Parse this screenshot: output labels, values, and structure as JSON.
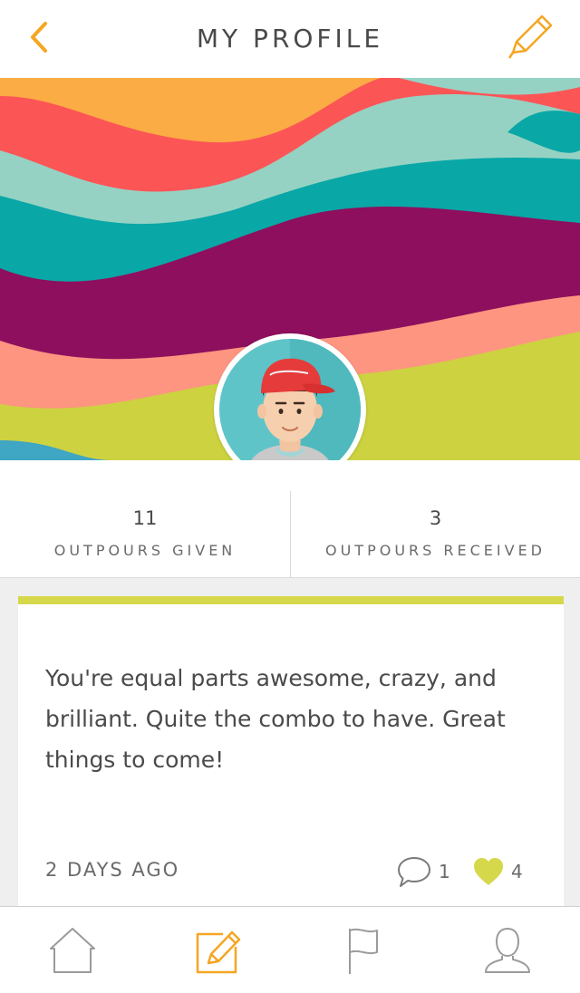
{
  "header": {
    "title": "MY PROFILE",
    "back_icon": "chevron-left-icon",
    "edit_icon": "pencil-icon"
  },
  "profile": {
    "avatar": "avatar-icon",
    "stats": [
      {
        "value": "11",
        "label": "OUTPOURS GIVEN"
      },
      {
        "value": "3",
        "label": "OUTPOURS RECEIVED"
      }
    ]
  },
  "post": {
    "message": "You're equal parts awesome, crazy, and brilliant. Quite the combo to have.  Great things to come!",
    "time": "2 DAYS AGO",
    "comment_count": "1",
    "like_count": "4"
  },
  "tabs": [
    {
      "name": "home",
      "icon": "home-icon"
    },
    {
      "name": "compose",
      "icon": "compose-icon"
    },
    {
      "name": "flag",
      "icon": "flag-icon"
    },
    {
      "name": "profile",
      "icon": "person-icon"
    }
  ],
  "colors": {
    "accent": "#f5a623",
    "card_bar": "#d6d84b",
    "heart": "#d6d84b",
    "banner_teal": "#0aa7a7",
    "banner_purple": "#8e0f5d",
    "banner_salmon": "#fd9581",
    "banner_coral": "#fc5556",
    "banner_orange": "#fbac44",
    "banner_mint": "#96d2c3",
    "banner_lime": "#cdd240"
  }
}
